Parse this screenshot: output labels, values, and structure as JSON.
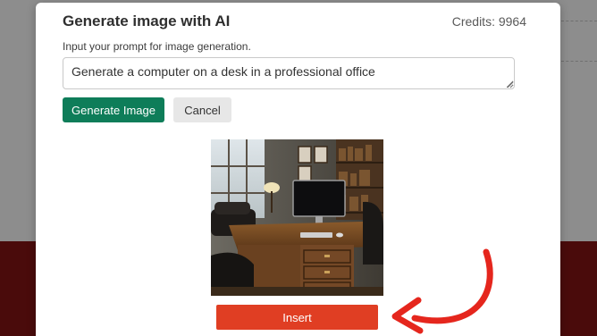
{
  "modal": {
    "title": "Generate image with AI",
    "credits": "Credits: 9964",
    "prompt_label": "Input your prompt for image generation.",
    "prompt_value": "Generate a computer on a desk in a professional office",
    "generate_button": "Generate Image",
    "cancel_button": "Cancel",
    "insert_button": "Insert"
  },
  "colors": {
    "generate_button": "#0e7d59",
    "insert_button": "#e03e23",
    "annotation_arrow": "#e5261d"
  },
  "icons": {
    "resize": "resize-grip-icon",
    "annotation": "red-curved-arrow-icon"
  }
}
